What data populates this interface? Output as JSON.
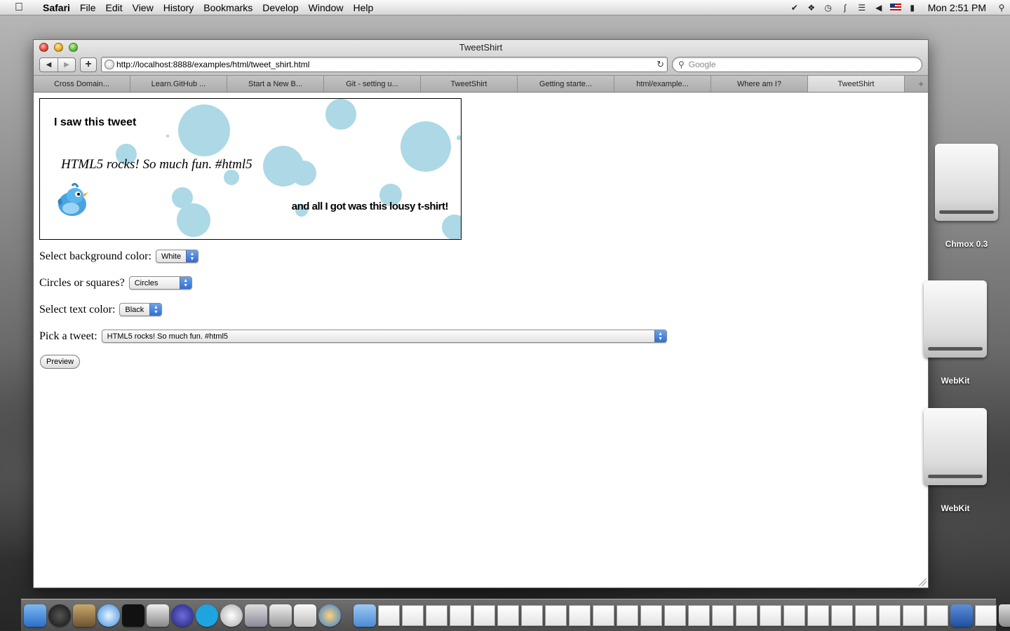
{
  "menubar": {
    "app": "Safari",
    "items": [
      "File",
      "Edit",
      "View",
      "History",
      "Bookmarks",
      "Develop",
      "Window",
      "Help"
    ],
    "clock": "Mon 2:51 PM"
  },
  "window": {
    "title": "TweetShirt",
    "url": "http://localhost:8888/examples/html/tweet_shirt.html",
    "search_placeholder": "Google",
    "tabs": [
      {
        "label": "Cross Domain..."
      },
      {
        "label": "Learn.GitHub ..."
      },
      {
        "label": "Start a New B..."
      },
      {
        "label": "Git - setting u..."
      },
      {
        "label": "TweetShirt"
      },
      {
        "label": "Getting starte..."
      },
      {
        "label": "html/example..."
      },
      {
        "label": "Where am I?"
      },
      {
        "label": "TweetShirt"
      }
    ]
  },
  "canvas": {
    "heading": "I saw this tweet",
    "tweet": "HTML5 rocks! So much fun. #html5",
    "tagline": "and all I got was this lousy t-shirt!",
    "circle_color": "#add8e6"
  },
  "form": {
    "bg_label": "Select background color:",
    "bg_value": "White",
    "shape_label": "Circles or squares?",
    "shape_value": "Circles",
    "text_label": "Select text color:",
    "text_value": "Black",
    "tweet_label": "Pick a tweet:",
    "tweet_value": "HTML5 rocks! So much fun. #html5",
    "preview": "Preview"
  },
  "desktop": {
    "drives": [
      {
        "label": "Chmox 0.3"
      },
      {
        "label": "WebKit"
      },
      {
        "label": "WebKit"
      }
    ]
  }
}
